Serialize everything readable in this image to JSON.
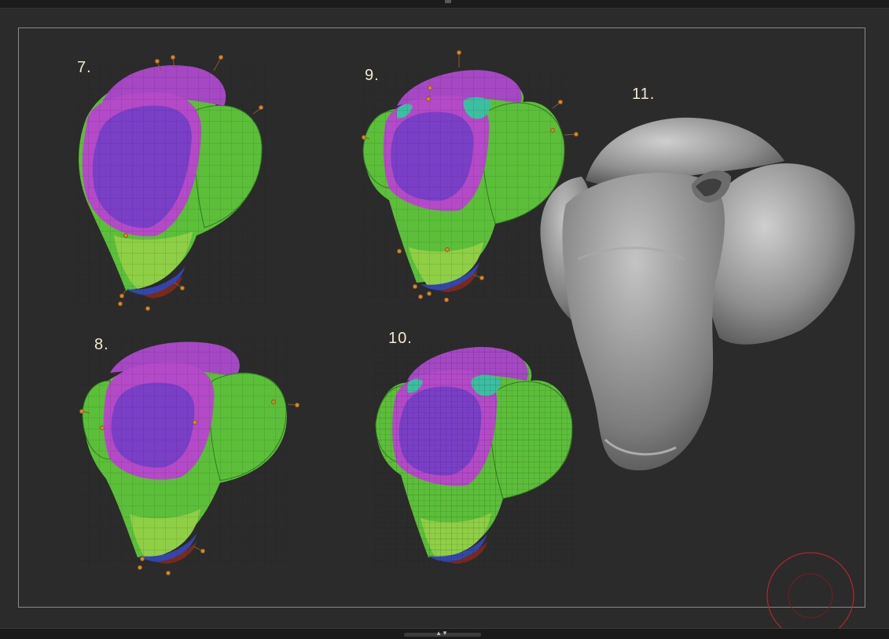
{
  "stages": [
    {
      "label": "7."
    },
    {
      "label": "8."
    },
    {
      "label": "9."
    },
    {
      "label": "10."
    },
    {
      "label": "11."
    }
  ],
  "colors": {
    "background": "#2b2b2b",
    "frame": "#8a8a8a",
    "label": "#f5e8d2",
    "purple": "#7a3fc7",
    "magenta": "#b54ac9",
    "green": "#5cbf3a",
    "light_green": "#8fcf45",
    "blue": "#3346b0",
    "teal": "#3bbfa0",
    "gray_mesh": "#9a9a9a",
    "navigator_ring": "#b0282a"
  },
  "icons": {
    "navigator": "red-circle-navigator-icon",
    "panel_toggle": "up-down-arrows-icon"
  }
}
